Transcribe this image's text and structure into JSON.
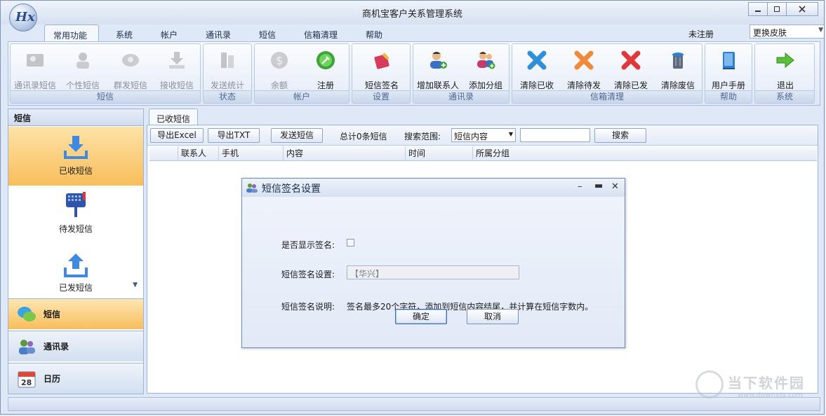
{
  "window": {
    "title": "商机宝客户关系管理系统",
    "logo_text": "Hx"
  },
  "ribbon_tabs": [
    "常用功能",
    "系统",
    "帐户",
    "通讯录",
    "短信",
    "信箱清理",
    "帮助"
  ],
  "header_right": {
    "unregistered": "未注册",
    "skin_select": "更换皮肤"
  },
  "ribbon_groups": [
    {
      "title": "短信",
      "buttons": [
        "通讯录短信",
        "个性短信",
        "群发短信",
        "接收短信"
      ]
    },
    {
      "title": "状态",
      "buttons": [
        "发送统计"
      ]
    },
    {
      "title": "帐户",
      "buttons": [
        "余额",
        "注册"
      ]
    },
    {
      "title": "设置",
      "buttons": [
        "短信签名"
      ]
    },
    {
      "title": "通讯录",
      "buttons": [
        "增加联系人",
        "添加分组"
      ]
    },
    {
      "title": "信箱清理",
      "buttons": [
        "清除已收",
        "清除待发",
        "清除已发",
        "清除废信"
      ]
    },
    {
      "title": "帮助",
      "buttons": [
        "用户手册"
      ]
    },
    {
      "title": "系统",
      "buttons": [
        "退出"
      ]
    }
  ],
  "left_panel": {
    "header": "短信",
    "items": [
      "已收短信",
      "待发短信",
      "已发短信"
    ],
    "nav": [
      "短信",
      "通讯录",
      "日历"
    ],
    "calendar_day": "28"
  },
  "content": {
    "tab": "已收短信",
    "toolbar": {
      "export_excel": "导出Excel",
      "export_txt": "导出TXT",
      "send_sms": "发送短信",
      "total": "总计0条短信",
      "search_scope_label": "搜索范围:",
      "search_scope_value": "短信内容",
      "search_button": "搜索"
    },
    "columns": [
      "联系人",
      "手机",
      "内容",
      "时间",
      "所属分组"
    ]
  },
  "dialog": {
    "title": "短信签名设置",
    "show_signature_label": "是否显示签名:",
    "signature_setting_label": "短信签名设置:",
    "signature_value": "【华兴】",
    "description_label": "短信签名说明:",
    "description_text": "签名最多20个字符，添加到短信内容结尾，并计算在短信字数内。",
    "ok": "确定",
    "cancel": "取消"
  },
  "watermark": {
    "brand": "当下软件园",
    "url": "www.downxia.com"
  },
  "colors": {
    "accent_orange": "#f9bd5b",
    "frame_blue": "#9fb3d4",
    "title_blue": "#dbe6f5"
  }
}
